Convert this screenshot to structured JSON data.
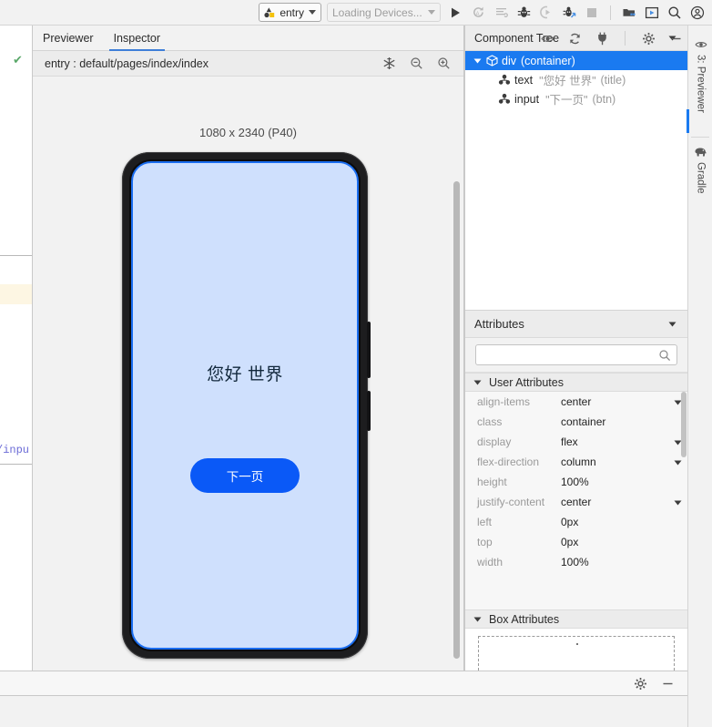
{
  "toolbar": {
    "run_config": {
      "label": "entry",
      "icon": "module-icon",
      "dropdown_icon": "chevron-down-icon"
    },
    "device_selector": {
      "label": "Loading Devices...",
      "dropdown_icon": "chevron-down-icon"
    },
    "actions": [
      {
        "name": "run-button",
        "icon": "play-icon",
        "enabled": true
      },
      {
        "name": "rerun-button",
        "icon": "rerun-icon",
        "enabled": false
      },
      {
        "name": "run-with-coverage-button",
        "icon": "coverage-icon",
        "enabled": false
      },
      {
        "name": "debug-button",
        "icon": "bug-icon",
        "enabled": true
      },
      {
        "name": "attach-profiler-button",
        "icon": "profiler-icon",
        "enabled": false
      },
      {
        "name": "attach-debugger-button",
        "icon": "attach-debug-icon",
        "enabled": true
      },
      {
        "name": "stop-button",
        "icon": "stop-icon",
        "enabled": false
      }
    ],
    "right_actions": [
      {
        "name": "device-manager-button",
        "icon": "device-manager-icon"
      },
      {
        "name": "device-file-explorer-button",
        "icon": "device-frame-icon"
      },
      {
        "name": "search-everywhere-button",
        "icon": "search-icon"
      },
      {
        "name": "account-button",
        "icon": "account-icon"
      }
    ]
  },
  "preview": {
    "tabs": [
      {
        "label": "Previewer",
        "active": false
      },
      {
        "label": "Inspector",
        "active": true
      }
    ],
    "inspector_path": "entry : default/pages/index/index",
    "inspector_tools": [
      {
        "name": "freeze-layout-button",
        "icon": "snowflake-icon"
      },
      {
        "name": "zoom-out-button",
        "icon": "zoom-out-icon"
      },
      {
        "name": "zoom-in-button",
        "icon": "zoom-in-icon"
      }
    ],
    "device_label": "1080 x 2340 (P40)",
    "screen": {
      "title_text": "您好 世界",
      "button_text": "下一页",
      "background_color": "#cfe0fd",
      "button_color": "#0a59f7",
      "selection_color": "#1a6df0"
    }
  },
  "component_tree": {
    "title": "Component Tree",
    "collapse_icon": "chevron-down-icon",
    "nodes": [
      {
        "name": "div",
        "value": "",
        "type": "(container)",
        "selected": true,
        "icon": "cube-icon",
        "twisty": "chevron-down-icon",
        "depth": 0
      },
      {
        "name": "text",
        "value": "\"您好 世界\"",
        "type": "(title)",
        "selected": false,
        "icon": "component-icon",
        "twisty": "",
        "depth": 1
      },
      {
        "name": "input",
        "value": "\"下一页\"",
        "type": "(btn)",
        "selected": false,
        "icon": "component-icon",
        "twisty": "",
        "depth": 1
      }
    ]
  },
  "attributes": {
    "title": "Attributes",
    "collapse_icon": "chevron-down-icon",
    "search": {
      "value": "",
      "placeholder": "",
      "icon": "search-icon"
    },
    "groups": [
      {
        "name": "User Attributes",
        "expanded": true,
        "twisty": "chevron-down-icon",
        "rows": [
          {
            "key": "align-items",
            "value": "center",
            "dropdown": true
          },
          {
            "key": "class",
            "value": "container",
            "dropdown": false
          },
          {
            "key": "display",
            "value": "flex",
            "dropdown": true
          },
          {
            "key": "flex-direction",
            "value": "column",
            "dropdown": true
          },
          {
            "key": "height",
            "value": "100%",
            "dropdown": false
          },
          {
            "key": "justify-content",
            "value": "center",
            "dropdown": true
          },
          {
            "key": "left",
            "value": "0px",
            "dropdown": false
          },
          {
            "key": "top",
            "value": "0px",
            "dropdown": false
          },
          {
            "key": "width",
            "value": "100%",
            "dropdown": false
          }
        ]
      },
      {
        "name": "Box Attributes",
        "expanded": true,
        "twisty": "chevron-down-icon",
        "rows": []
      }
    ]
  },
  "panel_header_tools": [
    {
      "name": "preview-visibility-button",
      "icon": "eye-icon"
    },
    {
      "name": "refresh-preview-button",
      "icon": "refresh-icon"
    },
    {
      "name": "disconnect-button",
      "icon": "plug-icon"
    },
    {
      "name": "settings-button",
      "icon": "gear-icon"
    },
    {
      "name": "hide-panel-button",
      "icon": "minimize-icon"
    }
  ],
  "bottom_bar_tools": [
    {
      "name": "settings-button",
      "icon": "gear-icon"
    },
    {
      "name": "hide-panel-button",
      "icon": "minimize-icon"
    }
  ],
  "right_stripe": [
    {
      "label": "3: Previewer",
      "icon": "eye-icon",
      "active": true
    },
    {
      "label": "Gradle",
      "icon": "elephant-icon",
      "active": false
    }
  ],
  "editor_strip": {
    "gutter_mark": "✔",
    "code_fragment": "/inpu"
  }
}
